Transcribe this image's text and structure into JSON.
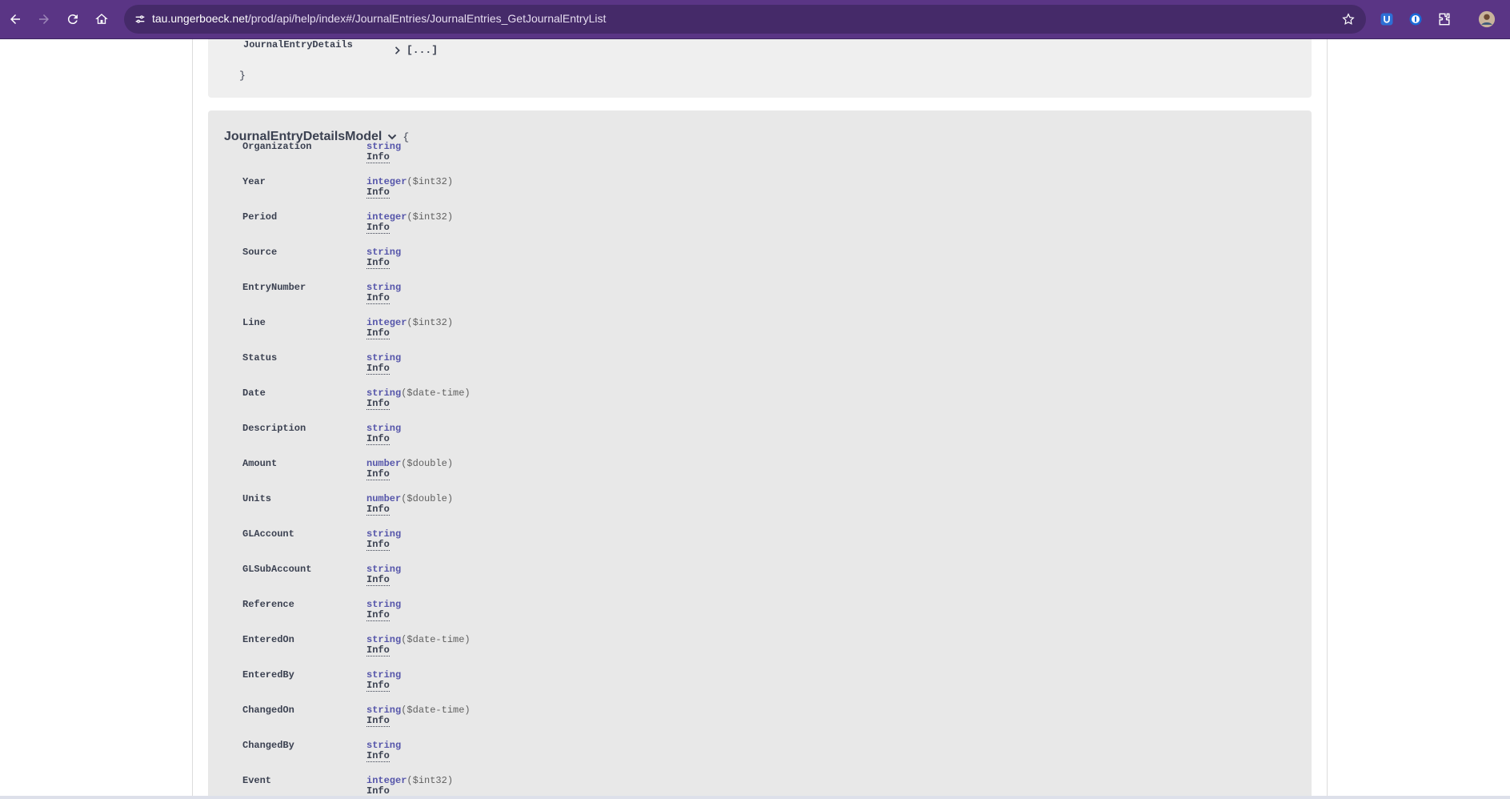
{
  "browser": {
    "url_host": "tau.ungerboeck.net",
    "url_path": "/prod/api/help/index#/JournalEntries/JournalEntries_GetJournalEntryList",
    "icons": [
      "back-icon",
      "forward-icon",
      "reload-icon",
      "home-icon",
      "site-info-icon",
      "star-icon",
      "extension-u-icon",
      "password-manager-icon",
      "extensions-puzzle-icon",
      "profile-avatar"
    ]
  },
  "prev_model": {
    "property_name": "JournalEntryDetails",
    "collapsed_value": "[...]",
    "closing_brace": "}"
  },
  "model": {
    "title": "JournalEntryDetailsModel",
    "open_brace": "{",
    "info_label": "Info",
    "properties": [
      {
        "name": "Organization",
        "type": "string",
        "format": ""
      },
      {
        "name": "Year",
        "type": "integer",
        "format": "($int32)"
      },
      {
        "name": "Period",
        "type": "integer",
        "format": "($int32)"
      },
      {
        "name": "Source",
        "type": "string",
        "format": ""
      },
      {
        "name": "EntryNumber",
        "type": "string",
        "format": ""
      },
      {
        "name": "Line",
        "type": "integer",
        "format": "($int32)"
      },
      {
        "name": "Status",
        "type": "string",
        "format": ""
      },
      {
        "name": "Date",
        "type": "string",
        "format": "($date-time)"
      },
      {
        "name": "Description",
        "type": "string",
        "format": ""
      },
      {
        "name": "Amount",
        "type": "number",
        "format": "($double)"
      },
      {
        "name": "Units",
        "type": "number",
        "format": "($double)"
      },
      {
        "name": "GLAccount",
        "type": "string",
        "format": ""
      },
      {
        "name": "GLSubAccount",
        "type": "string",
        "format": ""
      },
      {
        "name": "Reference",
        "type": "string",
        "format": ""
      },
      {
        "name": "EnteredOn",
        "type": "string",
        "format": "($date-time)"
      },
      {
        "name": "EnteredBy",
        "type": "string",
        "format": ""
      },
      {
        "name": "ChangedOn",
        "type": "string",
        "format": "($date-time)"
      },
      {
        "name": "ChangedBy",
        "type": "string",
        "format": ""
      },
      {
        "name": "Event",
        "type": "integer",
        "format": "($int32)"
      }
    ]
  },
  "colors": {
    "toolbar": "#5a3585",
    "omnibox": "#452a69",
    "model_bg": "#e8e8e8",
    "type_color": "#55a"
  }
}
